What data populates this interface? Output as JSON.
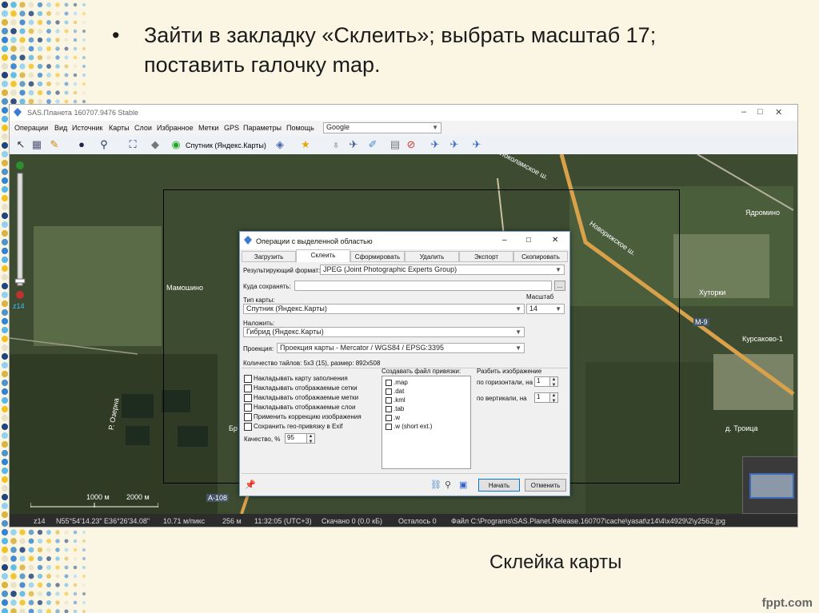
{
  "slide": {
    "bullet": "•",
    "text": "Зайти в закладку «Склеить»; выбрать масштаб 17; поставить галочку map.",
    "caption": "Склейка карты",
    "footer": "fppt.com"
  },
  "app": {
    "title": "SAS.Планета 160707.9476 Stable",
    "menu": [
      "Операции",
      "Вид",
      "Источник",
      "Карты",
      "Слои",
      "Избранное",
      "Метки",
      "GPS",
      "Параметры",
      "Помощь"
    ],
    "search_combo": "Google",
    "toolbar_map": "Спутник (Яндекс.Карты)",
    "icons": [
      "cursor-icon",
      "layers-icon",
      "ruler-icon",
      "globe-icon",
      "zoom-icon",
      "fullscreen-icon",
      "satellite-icon",
      "source-icon",
      "layers-menu-icon",
      "star-icon",
      "marker-icon",
      "path-icon",
      "poly-icon",
      "cache-icon",
      "noconnection-icon",
      "plane-icon",
      "plane2-icon",
      "plane3-icon"
    ]
  },
  "map": {
    "labels": [
      "Волоколамское ш.",
      "Ядромино",
      "Новорижское ш.",
      "Хуторки",
      "Мамошино",
      "Курсаково-1",
      "М-9",
      "Р. Озерна",
      "Бр",
      "А-108",
      "д. Троица",
      "1000 м",
      "2000 м"
    ],
    "zoom_label": "z14"
  },
  "statusbar": {
    "zoom": "z14",
    "coords": "N55°54'14.23\" E36°26'34.08\"",
    "scale": "10.71 м/пикс",
    "alt": "256 м",
    "time": "11:32:05 (UTC+3)",
    "downloaded": "Скачано 0 (0.0 кБ)",
    "remaining": "Осталось 0",
    "file": "Файл C:\\Programs\\SAS.Planet.Release.160707\\cache\\yasat\\z14\\4\\x4929\\2\\y2562.jpg"
  },
  "dialog": {
    "title": "Операции с выделенной областью",
    "tabs": [
      "Загрузить",
      "Склеить",
      "Сформировать",
      "Удалить",
      "Экспорт",
      "Скопировать"
    ],
    "result_format_label": "Результирующий формат:",
    "result_format_value": "JPEG (Joint Photographic Experts Group)",
    "save_to_label": "Куда сохранять:",
    "save_to_value": "",
    "browse": "...",
    "map_type_label": "Тип карты:",
    "map_type_value": "Спутник (Яндекс.Карты)",
    "scale_label": "Масштаб",
    "scale_value": "14",
    "overlay_label": "Наложить:",
    "overlay_value": "Гибрид (Яндекс.Карты)",
    "projection_label": "Проекция:",
    "projection_value": "Проекция карты - Mercator / WGS84 / EPSG:3395",
    "tiles_count": "Количество тайлов: 5x3 (15), размер: 892x508",
    "options": [
      "Накладывать карту заполнения",
      "Накладывать отображаемые сетки",
      "Накладывать отображаемые метки",
      "Накладывать отображаемые слои",
      "Применить коррекцию изображения",
      "Сохранить гео-привязку в Exif"
    ],
    "quality_label": "Качество, %",
    "quality_value": "95",
    "bind_files_label": "Создавать файл привязки:",
    "bind_files": [
      ".map",
      ".dat",
      ".kml",
      ".tab",
      ".w",
      ".w (short ext.)"
    ],
    "split_label": "Разбить изображение",
    "split_h_label": "по горизонтали, на",
    "split_h_value": "1",
    "split_v_label": "по вертикали, на",
    "split_v_value": "1",
    "start_button": "Начать",
    "cancel_button": "Отменить"
  },
  "colors": {
    "slide_bg": "#fbf6e4",
    "dialog_border": "#7a9cc9",
    "primary_button_border": "#0078d7",
    "road": "#e0a84a"
  }
}
